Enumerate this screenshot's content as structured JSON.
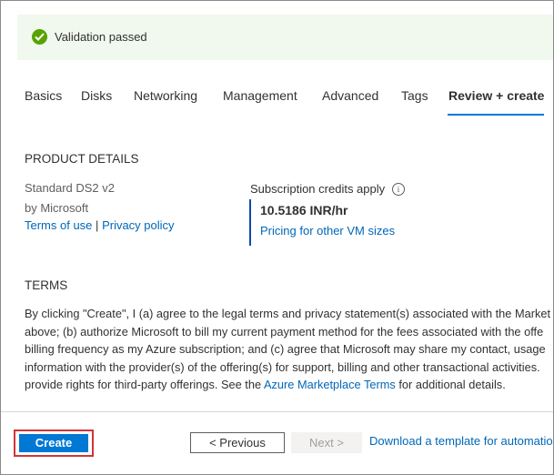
{
  "banner": {
    "text": "Validation passed",
    "status_color": "#57a300",
    "icon": "checkmark-circle-icon"
  },
  "tabs": [
    {
      "label": "Basics",
      "active": false
    },
    {
      "label": "Disks",
      "active": false
    },
    {
      "label": "Networking",
      "active": false
    },
    {
      "label": "Management",
      "active": false
    },
    {
      "label": "Advanced",
      "active": false
    },
    {
      "label": "Tags",
      "active": false
    },
    {
      "label": "Review + create",
      "active": true
    }
  ],
  "product": {
    "heading": "PRODUCT DETAILS",
    "name": "Standard DS2 v2",
    "publisher": "by Microsoft",
    "terms_link": "Terms of use",
    "separator": "|",
    "privacy_link": "Privacy policy",
    "credits_label": "Subscription credits apply",
    "price": "10.5186 INR/hr",
    "pricing_link": "Pricing for other VM sizes"
  },
  "terms": {
    "heading": "TERMS",
    "lines": [
      "By clicking \"Create\", I (a) agree to the legal terms and privacy statement(s) associated with the Market",
      "above; (b) authorize Microsoft to bill my current payment method for the fees associated with the offe",
      "billing frequency as my Azure subscription; and (c) agree that Microsoft may share my contact, usage",
      "information with the provider(s) of the offering(s) for support, billing and other transactional activities."
    ],
    "last_line_before": "provide rights for third-party offerings. See the ",
    "marketplace_link": "Azure Marketplace Terms",
    "last_line_after": " for additional details."
  },
  "footer": {
    "create_label": "Create",
    "previous_label": "< Previous",
    "next_label": "Next >",
    "download_link": "Download a template for automatio"
  },
  "colors": {
    "accent": "#0078d4",
    "link": "#0067b8",
    "highlight": "#d13438"
  }
}
